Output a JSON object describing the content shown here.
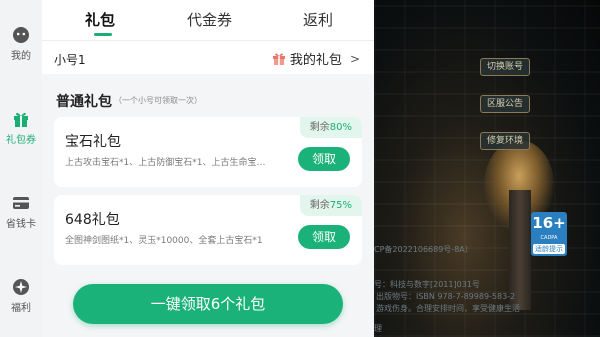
{
  "sidebar": {
    "items": [
      {
        "label": "我的",
        "icon": "face-icon"
      },
      {
        "label": "礼包券",
        "icon": "gift-icon",
        "active": true
      },
      {
        "label": "省钱卡",
        "icon": "card-icon"
      },
      {
        "label": "福利",
        "icon": "star-icon"
      }
    ]
  },
  "tabs": [
    {
      "label": "礼包",
      "active": true
    },
    {
      "label": "代金券"
    },
    {
      "label": "返利"
    }
  ],
  "account": {
    "name": "小号1",
    "my_gifts": "我的礼包",
    "chevron": ">"
  },
  "section": {
    "title": "普通礼包",
    "subtitle": "（一个小号可领取一次）"
  },
  "gifts": [
    {
      "name": "宝石礼包",
      "desc": "上古攻击宝石*1、上古防御宝石*1、上古生命宝…",
      "remain_label": "剩余",
      "remain_pct": "80%",
      "button": "领取"
    },
    {
      "name": "648礼包",
      "desc": "全图神剑图纸*1、灵玉*10000、全套上古宝石*1",
      "remain_label": "剩余",
      "remain_pct": "75%",
      "button": "领取"
    }
  ],
  "claim_all": "一键领取6个礼包",
  "game": {
    "buttons": [
      "切换账号",
      "区服公告",
      "修复环境"
    ],
    "age_rating": {
      "number": "16+",
      "sub": "CADPA",
      "tip": "适龄提示"
    },
    "licence_lines": [
      "CP备2022106689号-8A）",
      "号：科技与数字[2011]031号",
      "出版物号：ISBN 978-7-89989-583-2",
      "游戏伤身。合理安排时间，享受健康生活",
      "理"
    ]
  },
  "colors": {
    "accent": "#1bb27a",
    "accent_light": "#e3f6ee",
    "panel_bg": "#f4f5f7"
  }
}
